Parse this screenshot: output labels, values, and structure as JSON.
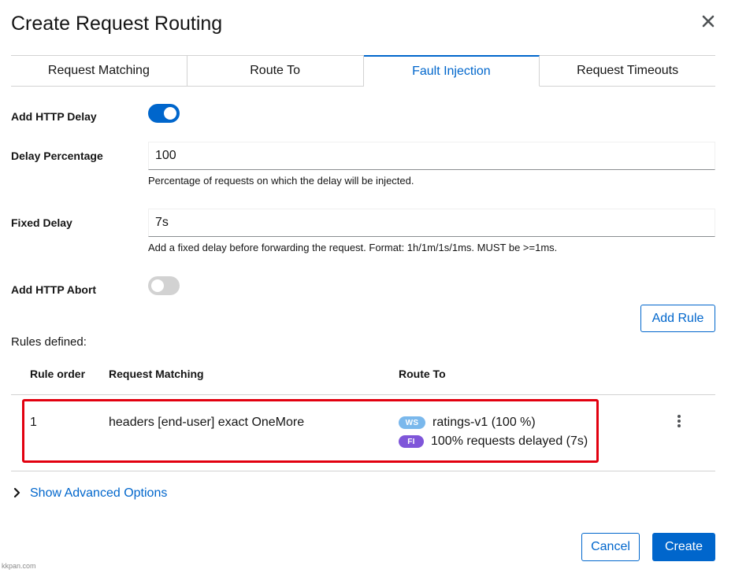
{
  "dialog": {
    "title": "Create Request Routing",
    "close_icon": "close-icon"
  },
  "tabs": [
    {
      "label": "Request Matching",
      "active": false
    },
    {
      "label": "Route To",
      "active": false
    },
    {
      "label": "Fault Injection",
      "active": true
    },
    {
      "label": "Request Timeouts",
      "active": false
    }
  ],
  "form": {
    "add_http_delay": {
      "label": "Add HTTP Delay",
      "enabled": true
    },
    "delay_percentage": {
      "label": "Delay Percentage",
      "value": "100",
      "help": "Percentage of requests on which the delay will be injected."
    },
    "fixed_delay": {
      "label": "Fixed Delay",
      "value": "7s",
      "help": "Add a fixed delay before forwarding the request. Format: 1h/1m/1s/1ms. MUST be >=1ms."
    },
    "add_http_abort": {
      "label": "Add HTTP Abort",
      "enabled": false
    },
    "add_rule_label": "Add Rule"
  },
  "rules": {
    "heading": "Rules defined:",
    "columns": [
      "Rule order",
      "Request Matching",
      "Route To"
    ],
    "rows": [
      {
        "order": "1",
        "matching": "headers [end-user] exact OneMore",
        "routes": [
          {
            "badge": "WS",
            "text": "ratings-v1 (100 %)"
          },
          {
            "badge": "FI",
            "text": "100% requests delayed (7s)"
          }
        ],
        "actions_icon": "kebab-icon"
      }
    ]
  },
  "advanced": {
    "label": "Show Advanced Options",
    "icon": "chevron-right-icon"
  },
  "footer": {
    "cancel_label": "Cancel",
    "create_label": "Create"
  },
  "watermark": {
    "site": "kkpan.com"
  },
  "colors": {
    "primary": "#0066cc",
    "ws_badge": "#7ab8ec",
    "fi_badge": "#7f56d9",
    "highlight": "#e2000f",
    "toggle_on": "#0066cc",
    "toggle_off": "#d2d2d2"
  }
}
